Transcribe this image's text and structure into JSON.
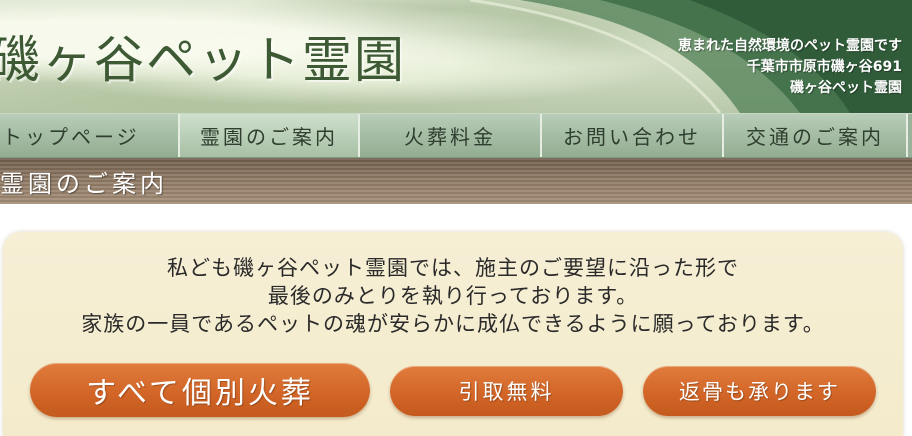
{
  "header": {
    "logo_text": "磯ヶ谷ペット霊園",
    "tagline": "恵まれた自然環境のペット霊園です",
    "address": "千葉市市原市磯ヶ谷691",
    "name": "磯ヶ谷ペット霊園"
  },
  "nav": {
    "items": [
      {
        "label": "トップページ"
      },
      {
        "label": "霊園のご案内"
      },
      {
        "label": "火葬料金"
      },
      {
        "label": "お問い合わせ"
      },
      {
        "label": "交通のご案内"
      }
    ],
    "active_index": 1
  },
  "section": {
    "title": "霊園のご案内"
  },
  "intro": {
    "lines": [
      "私ども磯ヶ谷ペット霊園では、施主のご要望に沿った形で",
      "最後のみとりを執り行っております。",
      "家族の一員であるペットの魂が安らかに成仏できるように願っております。"
    ]
  },
  "features": [
    {
      "label": "すべて個別火葬"
    },
    {
      "label": "引取無料"
    },
    {
      "label": "返骨も承ります"
    }
  ],
  "colors": {
    "brand_green": "#3d5a34",
    "nav_green": "#a3bba2",
    "section_brown": "#8d7762",
    "box_cream": "#f3ebcb",
    "accent_orange": "#d16426"
  }
}
